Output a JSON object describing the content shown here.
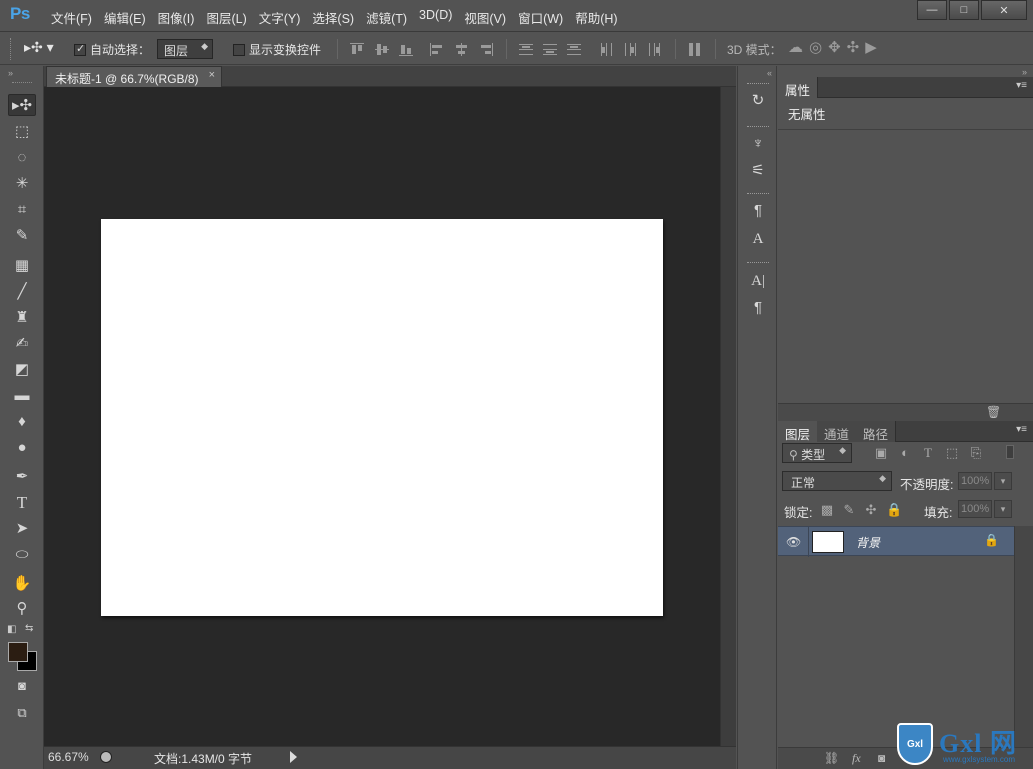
{
  "app": {
    "logo": "Ps"
  },
  "menu": [
    "文件(F)",
    "编辑(E)",
    "图像(I)",
    "图层(L)",
    "文字(Y)",
    "选择(S)",
    "滤镜(T)",
    "3D(D)",
    "视图(V)",
    "窗口(W)",
    "帮助(H)"
  ],
  "window_controls": {
    "minimize": "—",
    "restore": "□",
    "close": "✕"
  },
  "options_bar": {
    "auto_select_label": "自动选择：",
    "auto_select_checked": true,
    "auto_select_value": "图层",
    "show_transform_label": "显示变换控件",
    "show_transform_checked": false,
    "mode_3d_label": "3D 模式："
  },
  "document": {
    "tab_title": "未标题-1 @ 66.7%(RGB/8)",
    "tab_close": "×",
    "canvas_color": "#ffffff",
    "workspace_color": "#282828"
  },
  "status": {
    "zoom": "66.67%",
    "doc_info": "文档:1.43M/0 字节"
  },
  "tools": [
    "move-tool-icon",
    "marquee-tool-icon",
    "lasso-tool-icon",
    "magic-wand-icon",
    "crop-tool-icon",
    "eyedropper-icon",
    "healing-brush-icon",
    "brush-tool-icon",
    "clone-stamp-icon",
    "history-brush-icon",
    "eraser-icon",
    "gradient-tool-icon",
    "blur-tool-icon",
    "dodge-tool-icon",
    "pen-tool-icon",
    "type-tool-icon",
    "path-selection-icon",
    "ellipse-tool-icon",
    "hand-tool-icon",
    "zoom-tool-icon"
  ],
  "colors": {
    "foreground": "#2b1d12",
    "background": "#000000",
    "accent": "#4aa4e8",
    "selected_layer": "#52627a"
  },
  "properties_panel": {
    "tab": "属性",
    "empty_text": "无属性"
  },
  "layers_panel": {
    "tabs": [
      "图层",
      "通道",
      "路径"
    ],
    "filter_kind": "类型",
    "blend_mode": "正常",
    "opacity_label": "不透明度:",
    "opacity_value": "100%",
    "lock_label": "锁定:",
    "fill_label": "填充:",
    "fill_value": "100%",
    "layers": [
      {
        "name": "背景",
        "visible": true,
        "locked": true
      }
    ]
  },
  "watermark": {
    "badge": "Gxl",
    "text": "Gxl 网",
    "url": "www.gxlsystem.com"
  }
}
